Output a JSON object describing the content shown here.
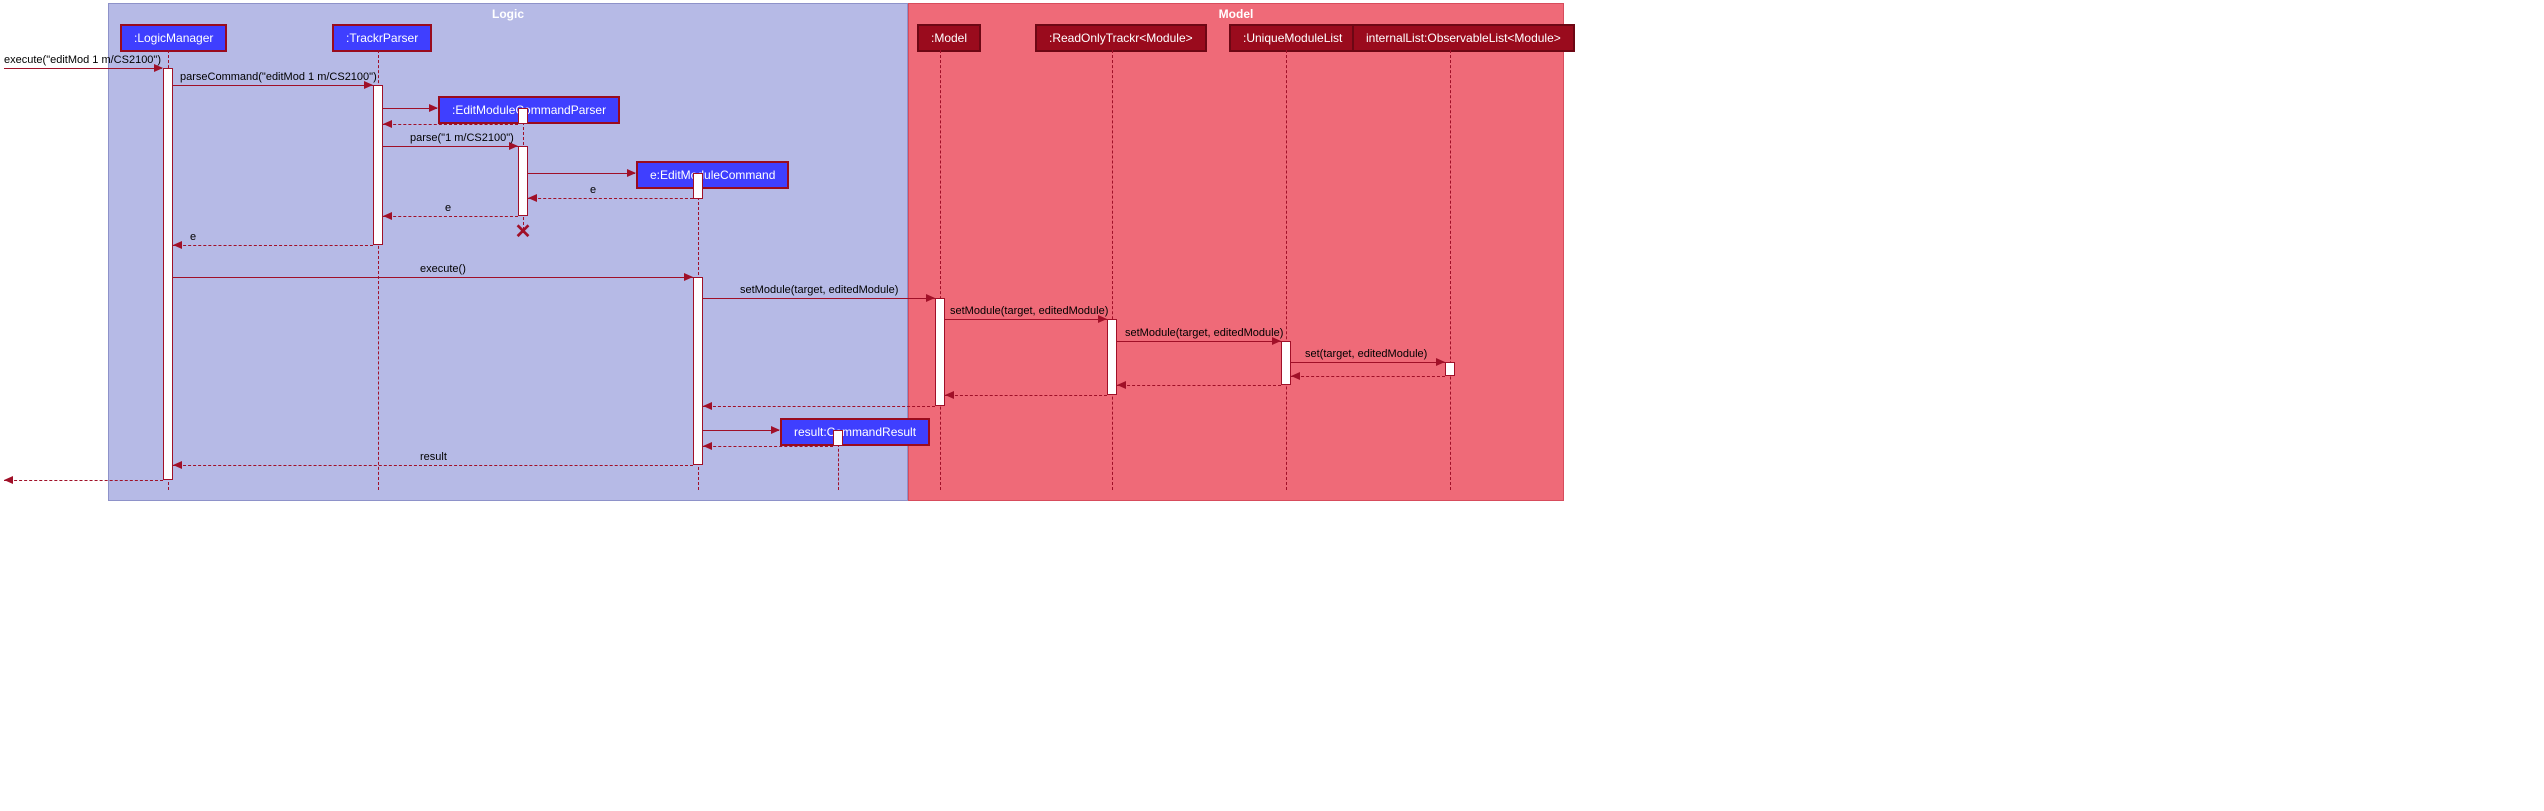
{
  "regions": {
    "logic": "Logic",
    "model": "Model"
  },
  "lifelines": {
    "logicManager": ":LogicManager",
    "trackrParser": ":TrackrParser",
    "editModuleCommandParser": ":EditModuleCommandParser",
    "editModuleCommand": "e:EditModuleCommand",
    "commandResult": "result:CommandResult",
    "model": ":Model",
    "readOnlyTrackr": ":ReadOnlyTrackr<Module>",
    "uniqueModuleList": ":UniqueModuleList",
    "observableList": "internalList:ObservableList<Module>"
  },
  "messages": {
    "m1": "execute(\"editMod 1 m/CS2100\")",
    "m2": "parseCommand(\"editMod 1 m/CS2100\")",
    "m3": "parse(\"1 m/CS2100\")",
    "m4_e1": "e",
    "m4_e2": "e",
    "m4_e3": "e",
    "m5": "execute()",
    "m6": "setModule(target, editedModule)",
    "m7": "setModule(target, editedModule)",
    "m8": "setModule(target, editedModule)",
    "m9": "set(target, editedModule)",
    "m10": "result"
  },
  "chart_data": {
    "type": "sequence-diagram",
    "regions": [
      {
        "name": "Logic",
        "participants": [
          ":LogicManager",
          ":TrackrParser",
          ":EditModuleCommandParser",
          "e:EditModuleCommand",
          "result:CommandResult"
        ]
      },
      {
        "name": "Model",
        "participants": [
          ":Model",
          ":ReadOnlyTrackr<Module>",
          ":UniqueModuleList",
          "internalList:ObservableList<Module>"
        ]
      }
    ],
    "messages": [
      {
        "from": "caller",
        "to": ":LogicManager",
        "label": "execute(\"editMod 1 m/CS2100\")",
        "kind": "sync"
      },
      {
        "from": ":LogicManager",
        "to": ":TrackrParser",
        "label": "parseCommand(\"editMod 1 m/CS2100\")",
        "kind": "sync"
      },
      {
        "from": ":TrackrParser",
        "to": ":EditModuleCommandParser",
        "label": "<<create>>",
        "kind": "sync"
      },
      {
        "from": ":EditModuleCommandParser",
        "to": ":TrackrParser",
        "label": "",
        "kind": "return"
      },
      {
        "from": ":TrackrParser",
        "to": ":EditModuleCommandParser",
        "label": "parse(\"1 m/CS2100\")",
        "kind": "sync"
      },
      {
        "from": ":EditModuleCommandParser",
        "to": "e:EditModuleCommand",
        "label": "<<create>>",
        "kind": "sync"
      },
      {
        "from": "e:EditModuleCommand",
        "to": ":EditModuleCommandParser",
        "label": "e",
        "kind": "return"
      },
      {
        "from": ":EditModuleCommandParser",
        "to": ":TrackrParser",
        "label": "e",
        "kind": "return"
      },
      {
        "note": ":EditModuleCommandParser destroyed"
      },
      {
        "from": ":TrackrParser",
        "to": ":LogicManager",
        "label": "e",
        "kind": "return"
      },
      {
        "from": ":LogicManager",
        "to": "e:EditModuleCommand",
        "label": "execute()",
        "kind": "sync"
      },
      {
        "from": "e:EditModuleCommand",
        "to": ":Model",
        "label": "setModule(target, editedModule)",
        "kind": "sync"
      },
      {
        "from": ":Model",
        "to": ":ReadOnlyTrackr<Module>",
        "label": "setModule(target, editedModule)",
        "kind": "sync"
      },
      {
        "from": ":ReadOnlyTrackr<Module>",
        "to": ":UniqueModuleList",
        "label": "setModule(target, editedModule)",
        "kind": "sync"
      },
      {
        "from": ":UniqueModuleList",
        "to": "internalList:ObservableList<Module>",
        "label": "set(target, editedModule)",
        "kind": "sync"
      },
      {
        "from": "internalList:ObservableList<Module>",
        "to": ":UniqueModuleList",
        "label": "",
        "kind": "return"
      },
      {
        "from": ":UniqueModuleList",
        "to": ":ReadOnlyTrackr<Module>",
        "label": "",
        "kind": "return"
      },
      {
        "from": ":ReadOnlyTrackr<Module>",
        "to": ":Model",
        "label": "",
        "kind": "return"
      },
      {
        "from": ":Model",
        "to": "e:EditModuleCommand",
        "label": "",
        "kind": "return"
      },
      {
        "from": "e:EditModuleCommand",
        "to": "result:CommandResult",
        "label": "<<create>>",
        "kind": "sync"
      },
      {
        "from": "result:CommandResult",
        "to": "e:EditModuleCommand",
        "label": "",
        "kind": "return"
      },
      {
        "from": "e:EditModuleCommand",
        "to": ":LogicManager",
        "label": "result",
        "kind": "return"
      },
      {
        "from": ":LogicManager",
        "to": "caller",
        "label": "",
        "kind": "return"
      }
    ]
  }
}
